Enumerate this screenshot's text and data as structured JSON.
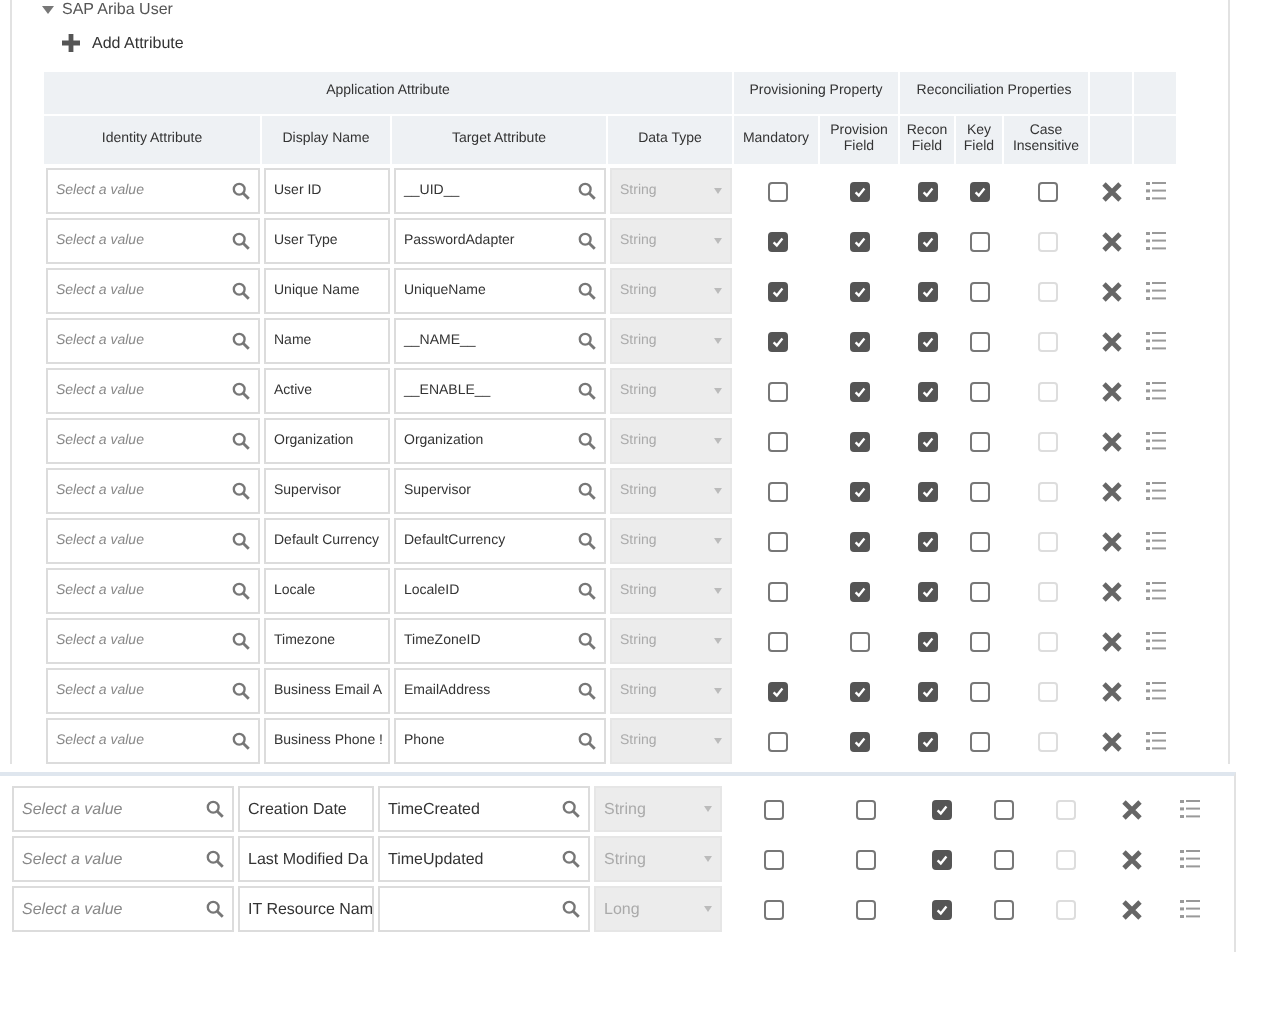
{
  "section_title": "SAP Ariba User",
  "add_button": {
    "label": "Add Attribute"
  },
  "header_groups": [
    {
      "kind": "application",
      "label": "Application Attribute"
    },
    {
      "kind": "provisioning",
      "label": "Provisioning Property"
    },
    {
      "kind": "reconciliation",
      "label": "Reconciliation Properties"
    }
  ],
  "columns": [
    "Identity Attribute",
    "Display Name",
    "Target Attribute",
    "Data Type",
    "Mandatory",
    "Provision Field",
    "Recon Field",
    "Key Field",
    "Case Insensitive"
  ],
  "rows": [
    {
      "identity_placeholder": "Select a value",
      "display_name": "User ID",
      "target": "__UID__",
      "data_type": "String",
      "mandatory": false,
      "provision_field": true,
      "recon_field": true,
      "key_field": true,
      "case_insensitive": {
        "checked": false,
        "disabled": false
      }
    },
    {
      "identity_placeholder": "Select a value",
      "display_name": "User Type",
      "target": "PasswordAdapter",
      "data_type": "String",
      "mandatory": true,
      "provision_field": true,
      "recon_field": true,
      "key_field": false,
      "case_insensitive": {
        "checked": false,
        "disabled": true
      }
    },
    {
      "identity_placeholder": "Select a value",
      "display_name": "Unique Name",
      "target": "UniqueName",
      "data_type": "String",
      "mandatory": true,
      "provision_field": true,
      "recon_field": true,
      "key_field": false,
      "case_insensitive": {
        "checked": false,
        "disabled": true
      }
    },
    {
      "identity_placeholder": "Select a value",
      "display_name": "Name",
      "target": "__NAME__",
      "data_type": "String",
      "mandatory": true,
      "provision_field": true,
      "recon_field": true,
      "key_field": false,
      "case_insensitive": {
        "checked": false,
        "disabled": true
      }
    },
    {
      "identity_placeholder": "Select a value",
      "display_name": "Active",
      "target": "__ENABLE__",
      "data_type": "String",
      "mandatory": false,
      "provision_field": true,
      "recon_field": true,
      "key_field": false,
      "case_insensitive": {
        "checked": false,
        "disabled": true
      }
    },
    {
      "identity_placeholder": "Select a value",
      "display_name": "Organization",
      "target": "Organization",
      "data_type": "String",
      "mandatory": false,
      "provision_field": true,
      "recon_field": true,
      "key_field": false,
      "case_insensitive": {
        "checked": false,
        "disabled": true
      }
    },
    {
      "identity_placeholder": "Select a value",
      "display_name": "Supervisor",
      "target": "Supervisor",
      "data_type": "String",
      "mandatory": false,
      "provision_field": true,
      "recon_field": true,
      "key_field": false,
      "case_insensitive": {
        "checked": false,
        "disabled": true
      }
    },
    {
      "identity_placeholder": "Select a value",
      "display_name": "Default Currency",
      "target": "DefaultCurrency",
      "data_type": "String",
      "mandatory": false,
      "provision_field": true,
      "recon_field": true,
      "key_field": false,
      "case_insensitive": {
        "checked": false,
        "disabled": true
      }
    },
    {
      "identity_placeholder": "Select a value",
      "display_name": "Locale",
      "target": "LocaleID",
      "data_type": "String",
      "mandatory": false,
      "provision_field": true,
      "recon_field": true,
      "key_field": false,
      "case_insensitive": {
        "checked": false,
        "disabled": true
      }
    },
    {
      "identity_placeholder": "Select a value",
      "display_name": "Timezone",
      "target": "TimeZoneID",
      "data_type": "String",
      "mandatory": false,
      "provision_field": false,
      "recon_field": true,
      "key_field": false,
      "case_insensitive": {
        "checked": false,
        "disabled": true
      }
    },
    {
      "identity_placeholder": "Select a value",
      "display_name": "Business Email A",
      "target": "EmailAddress",
      "data_type": "String",
      "mandatory": true,
      "provision_field": true,
      "recon_field": true,
      "key_field": false,
      "case_insensitive": {
        "checked": false,
        "disabled": true
      }
    },
    {
      "identity_placeholder": "Select a value",
      "display_name": "Business Phone !",
      "target": "Phone",
      "data_type": "String",
      "mandatory": false,
      "provision_field": true,
      "recon_field": true,
      "key_field": false,
      "case_insensitive": {
        "checked": false,
        "disabled": true
      }
    }
  ],
  "lower_rows": [
    {
      "identity_placeholder": "Select a value",
      "display_name": "Creation Date",
      "target": "TimeCreated",
      "data_type": "String",
      "mandatory": false,
      "provision_field": false,
      "recon_field": true,
      "key_field": false,
      "case_insensitive": {
        "checked": false,
        "disabled": true
      }
    },
    {
      "identity_placeholder": "Select a value",
      "display_name": "Last Modified Da",
      "target": "TimeUpdated",
      "data_type": "String",
      "mandatory": false,
      "provision_field": false,
      "recon_field": true,
      "key_field": false,
      "case_insensitive": {
        "checked": false,
        "disabled": true
      }
    },
    {
      "identity_placeholder": "Select a value",
      "display_name": "IT Resource Nam",
      "data_type": "Long",
      "mandatory": false,
      "provision_field": false,
      "recon_field": true,
      "key_field": false,
      "case_insensitive": {
        "checked": false,
        "disabled": true
      }
    }
  ]
}
